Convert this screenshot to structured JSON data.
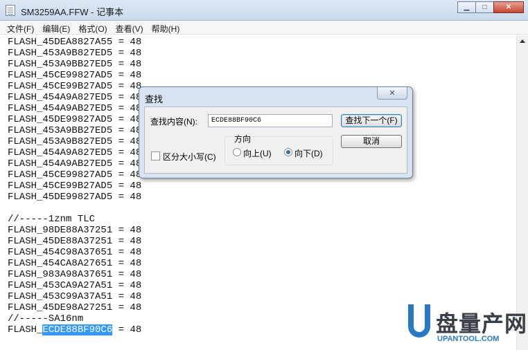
{
  "window": {
    "title": "SM3259AA.FFW - 记事本",
    "minimize_glyph": "▁",
    "maximize_glyph": "□",
    "close_glyph": "✕"
  },
  "menu": [
    "文件(F)",
    "编辑(E)",
    "格式(O)",
    "查看(V)",
    "帮助(H)"
  ],
  "editor": {
    "lines": [
      "FLASH_45DEA8827A55 = 48",
      "FLASH_453A9B827ED5 = 48",
      "FLASH_453A9BB27ED5 = 48",
      "FLASH_45CE99827AD5 = 48",
      "FLASH_45CE99B27AD5 = 48",
      "FLASH_454A9A827ED5 = 48",
      "FLASH_454A9AB27ED5 = 48",
      "FLASH_45DE99827AD5 = 48",
      "FLASH_453A9BB27ED5 = 48",
      "FLASH_453A9B827ED5 = 48",
      "FLASH_454A9A827ED5 = 48",
      "FLASH_454A9AB27ED5 = 48",
      "FLASH_45CE99827AD5 = 48",
      "FLASH_45CE99B27AD5 = 48",
      "FLASH_45DE99827AD5 = 48",
      "",
      "//-----1znm TLC",
      "FLASH_98DE88A37251 = 48",
      "FLASH_45DE88A37251 = 48",
      "FLASH_454C98A37651 = 48",
      "FLASH_454CA8A27651 = 48",
      "FLASH_983A98A37651 = 48",
      "FLASH_453CA9A27A51 = 48",
      "FLASH_453C99A37A51 = 48",
      "FLASH_45DE98A27251 = 48",
      "//-----SA16nm"
    ],
    "last_line": {
      "prefix": "FLASH_",
      "selected": "ECDE88BF90C6",
      "suffix": " = 48"
    }
  },
  "find_dialog": {
    "title": "查找",
    "close_glyph": "✕",
    "find_what_label": "查找内容(N):",
    "find_what_value": "ECDE88BF90C6",
    "find_next_button": "查找下一个(F)",
    "cancel_button": "取消",
    "match_case_label": "区分大小写(C)",
    "match_case_checked": false,
    "direction_label": "方向",
    "up_label": "向上(U)",
    "down_label": "向下(D)",
    "direction_selected": "down"
  },
  "watermark": {
    "brand": "盘量产网",
    "url": "UPANTOOL.COM"
  }
}
